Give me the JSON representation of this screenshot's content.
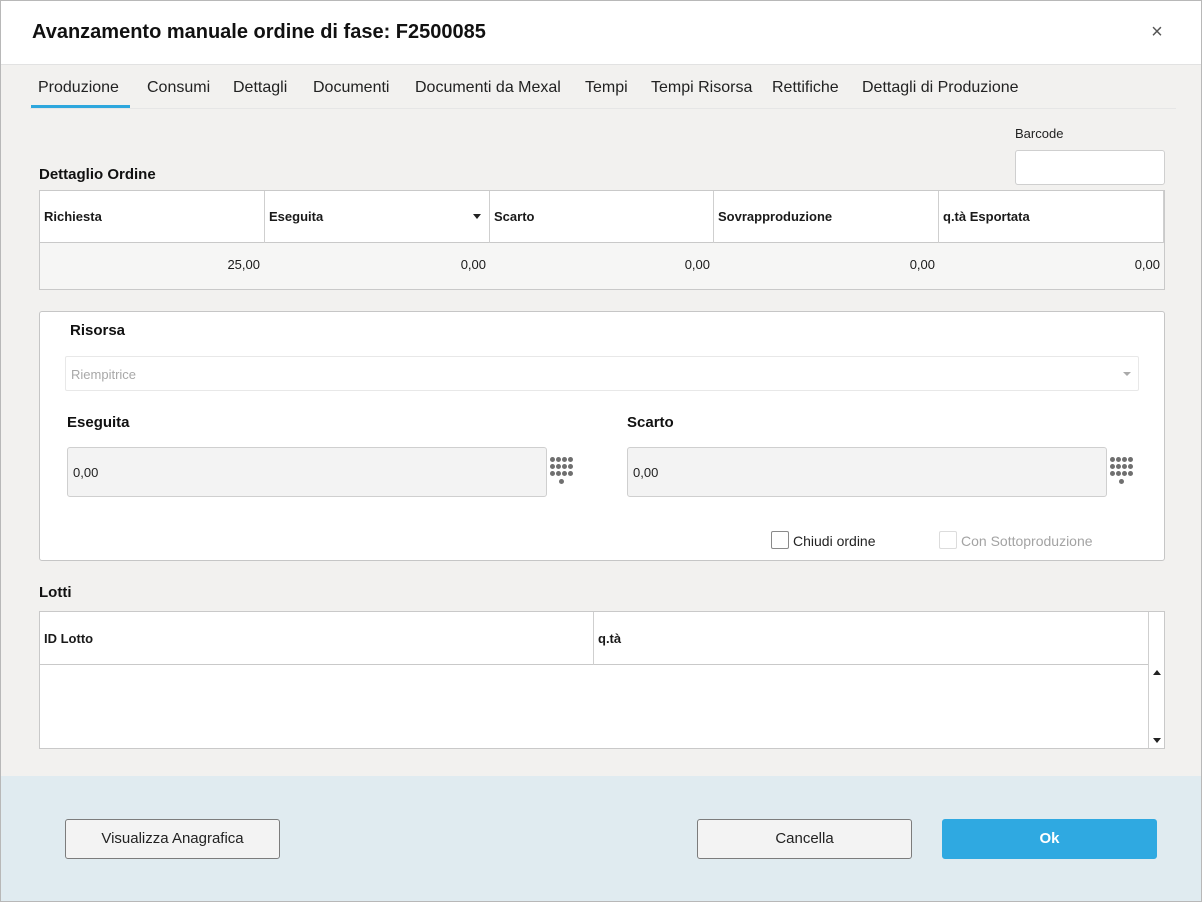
{
  "dialog": {
    "title": "Avanzamento manuale ordine di fase: F2500085",
    "close_glyph": "×"
  },
  "tabs": [
    {
      "label": "Produzione",
      "active": true
    },
    {
      "label": "Consumi"
    },
    {
      "label": "Dettagli"
    },
    {
      "label": "Documenti"
    },
    {
      "label": "Documenti da Mexal"
    },
    {
      "label": "Tempi"
    },
    {
      "label": "Tempi Risorsa"
    },
    {
      "label": "Rettifiche"
    },
    {
      "label": "Dettagli di Produzione"
    }
  ],
  "barcode": {
    "label": "Barcode",
    "value": ""
  },
  "order_detail": {
    "title": "Dettaglio Ordine",
    "columns": [
      "Richiesta",
      "Eseguita",
      "Scarto",
      "Sovrapproduzione",
      "q.tà Esportata"
    ],
    "row": [
      "25,00",
      "0,00",
      "0,00",
      "0,00",
      "0,00"
    ]
  },
  "resource": {
    "label": "Risorsa",
    "selected": "Riempitrice",
    "eseguita_label": "Eseguita",
    "eseguita_value": "0,00",
    "scarto_label": "Scarto",
    "scarto_value": "0,00",
    "close_order_label": "Chiudi ordine",
    "subproduction_label": "Con Sottoproduzione"
  },
  "lots": {
    "title": "Lotti",
    "columns": [
      "ID Lotto",
      "q.tà"
    ]
  },
  "footer": {
    "view_registry_label": "Visualizza Anagrafica",
    "cancel_label": "Cancella",
    "ok_label": "Ok"
  },
  "colors": {
    "accent": "#2fa9e1",
    "footer_bg": "#e0ebf0",
    "body_bg": "#f2f1ef"
  }
}
